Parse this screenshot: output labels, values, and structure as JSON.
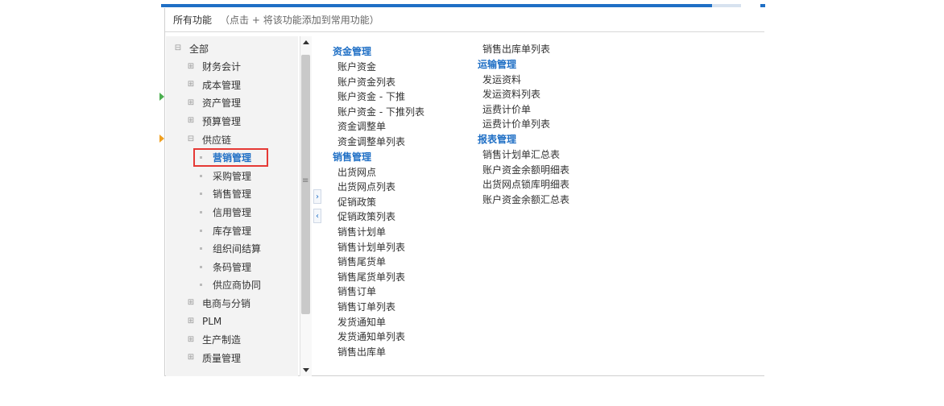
{
  "header": {
    "title": "所有功能",
    "hint": "（点击 + 将该功能添加到常用功能）"
  },
  "tree": {
    "root": "全部",
    "items": [
      {
        "label": "财务会计",
        "type": "collapsed"
      },
      {
        "label": "成本管理",
        "type": "collapsed"
      },
      {
        "label": "资产管理",
        "type": "collapsed"
      },
      {
        "label": "预算管理",
        "type": "collapsed"
      },
      {
        "label": "供应链",
        "type": "expanded"
      },
      {
        "label": "营销管理",
        "type": "child",
        "active": true
      },
      {
        "label": "采购管理",
        "type": "child"
      },
      {
        "label": "销售管理",
        "type": "child"
      },
      {
        "label": "信用管理",
        "type": "child"
      },
      {
        "label": "库存管理",
        "type": "child"
      },
      {
        "label": "组织间结算",
        "type": "child"
      },
      {
        "label": "条码管理",
        "type": "child"
      },
      {
        "label": "供应商协同",
        "type": "child"
      },
      {
        "label": "电商与分销",
        "type": "collapsed"
      },
      {
        "label": "PLM",
        "type": "collapsed"
      },
      {
        "label": "生产制造",
        "type": "collapsed"
      },
      {
        "label": "质量管理",
        "type": "collapsed"
      }
    ]
  },
  "columns": {
    "col1": {
      "groups": [
        {
          "heading": "资金管理",
          "items": [
            "账户资金",
            "账户资金列表",
            "账户资金 - 下推",
            "账户资金 - 下推列表",
            "资金调整单",
            "资金调整单列表"
          ]
        },
        {
          "heading": "销售管理",
          "items": [
            "出货网点",
            "出货网点列表",
            "促销政策",
            "促销政策列表",
            "销售计划单",
            "销售计划单列表",
            "销售尾货单",
            "销售尾货单列表",
            "销售订单",
            "销售订单列表",
            "发货通知单",
            "发货通知单列表",
            "销售出库单"
          ]
        }
      ]
    },
    "col2": {
      "lead_item": "销售出库单列表",
      "groups": [
        {
          "heading": "运输管理",
          "items": [
            "发运资料",
            "发运资料列表",
            "运费计价单",
            "运费计价单列表"
          ]
        },
        {
          "heading": "报表管理",
          "items": [
            "销售计划单汇总表",
            "账户资金余额明细表",
            "出货网点锁库明细表",
            "账户资金余额汇总表"
          ]
        }
      ]
    }
  },
  "icons": {
    "collapsed": "plus-box-icon",
    "expanded": "minus-box-icon",
    "child": "bullet-icon"
  },
  "colors": {
    "accent": "#1f6fc5",
    "highlight_border": "#e53935"
  }
}
